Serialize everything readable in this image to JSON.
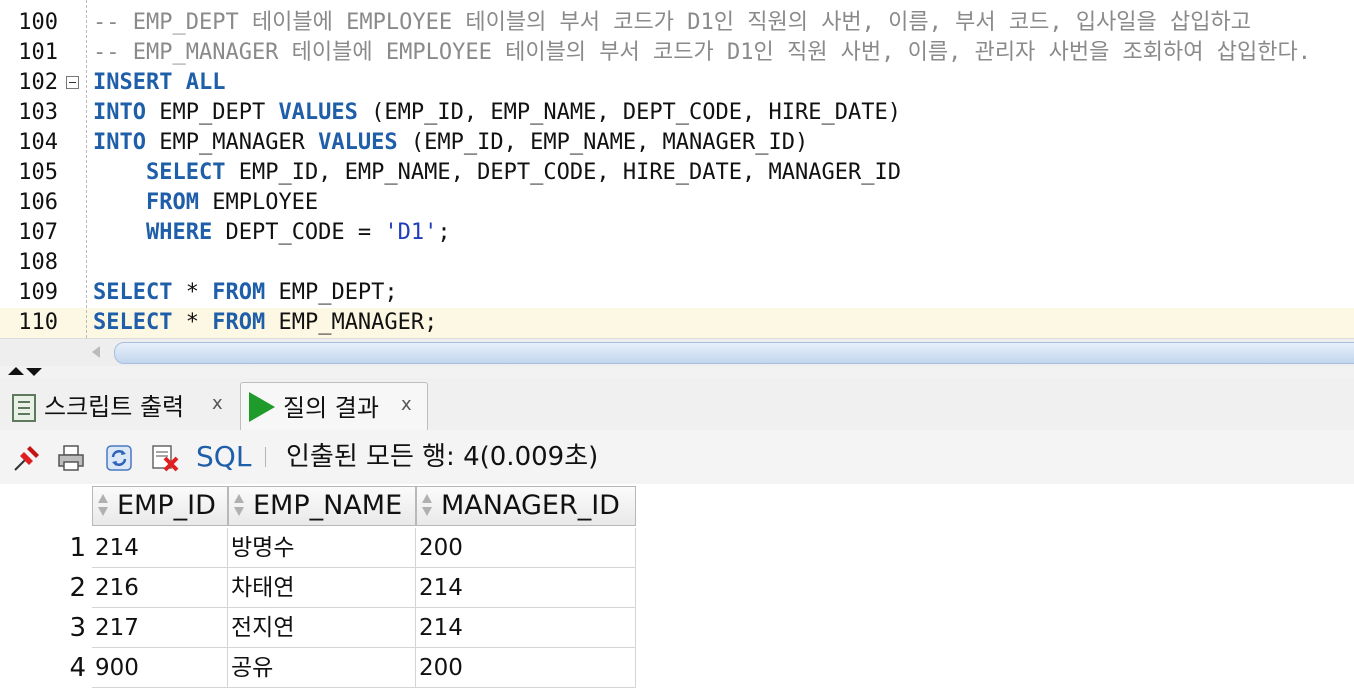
{
  "editor": {
    "lines": [
      {
        "num": "100",
        "parts": [
          {
            "t": "-- EMP_DEPT 테이블에 EMPLOYEE 테이블의 부서 코드가 D1인 직원의 사번, 이름, 부서 코드, 입사일을 삽입하고",
            "c": "comment"
          }
        ]
      },
      {
        "num": "101",
        "parts": [
          {
            "t": "-- EMP_MANAGER 테이블에 EMPLOYEE 테이블의 부서 코드가 D1인 직원 사번, 이름, 관리자 사번을 조회하여 삽입한다.",
            "c": "comment"
          }
        ]
      },
      {
        "num": "102",
        "parts": [
          {
            "t": "INSERT ALL",
            "c": "kw"
          }
        ]
      },
      {
        "num": "103",
        "parts": [
          {
            "t": "INTO",
            "c": "kw"
          },
          {
            "t": " EMP_DEPT "
          },
          {
            "t": "VALUES",
            "c": "kw"
          },
          {
            "t": " (EMP_ID, EMP_NAME, DEPT_CODE, HIRE_DATE)"
          }
        ]
      },
      {
        "num": "104",
        "parts": [
          {
            "t": "INTO",
            "c": "kw"
          },
          {
            "t": " EMP_MANAGER "
          },
          {
            "t": "VALUES",
            "c": "kw"
          },
          {
            "t": " (EMP_ID, EMP_NAME, MANAGER_ID)"
          }
        ]
      },
      {
        "num": "105",
        "parts": [
          {
            "t": "    "
          },
          {
            "t": "SELECT",
            "c": "kw"
          },
          {
            "t": " EMP_ID, EMP_NAME, DEPT_CODE, HIRE_DATE, MANAGER_ID"
          }
        ]
      },
      {
        "num": "106",
        "parts": [
          {
            "t": "    "
          },
          {
            "t": "FROM",
            "c": "kw"
          },
          {
            "t": " EMPLOYEE"
          }
        ]
      },
      {
        "num": "107",
        "parts": [
          {
            "t": "    "
          },
          {
            "t": "WHERE",
            "c": "kw"
          },
          {
            "t": " DEPT_CODE = "
          },
          {
            "t": "'D1'",
            "c": "str"
          },
          {
            "t": ";"
          }
        ]
      },
      {
        "num": "108",
        "parts": []
      },
      {
        "num": "109",
        "parts": [
          {
            "t": "SELECT",
            "c": "kw"
          },
          {
            "t": " * "
          },
          {
            "t": "FROM",
            "c": "kw"
          },
          {
            "t": " EMP_DEPT;"
          }
        ]
      },
      {
        "num": "110",
        "parts": [
          {
            "t": "SELECT",
            "c": "kw"
          },
          {
            "t": " * "
          },
          {
            "t": "FROM",
            "c": "kw"
          },
          {
            "t": " EMP_MANAGER;"
          }
        ],
        "current": true
      }
    ]
  },
  "tabs": [
    {
      "label": "스크립트 출력",
      "close": "x",
      "icon": "script-output-icon"
    },
    {
      "label": "질의 결과",
      "close": "x",
      "icon": "play-icon",
      "active": true
    }
  ],
  "toolbar": {
    "sql_label": "SQL",
    "status": "인출된 모든 행: 4(0.009초)",
    "icons": [
      "pin-icon",
      "print-icon",
      "refresh-icon",
      "delete-icon"
    ]
  },
  "grid": {
    "columns": [
      "EMP_ID",
      "EMP_NAME",
      "MANAGER_ID"
    ],
    "rows": [
      {
        "n": "1",
        "cells": [
          "214",
          "방명수",
          "200"
        ]
      },
      {
        "n": "2",
        "cells": [
          "216",
          "차태연",
          "214"
        ]
      },
      {
        "n": "3",
        "cells": [
          "217",
          "전지연",
          "214"
        ]
      },
      {
        "n": "4",
        "cells": [
          "900",
          "공유",
          "200"
        ]
      }
    ]
  },
  "colors": {
    "keyword": "#1f5ea8",
    "comment": "#8a8a8a",
    "string": "#1e3db8",
    "current_line": "#fdf8e4"
  }
}
